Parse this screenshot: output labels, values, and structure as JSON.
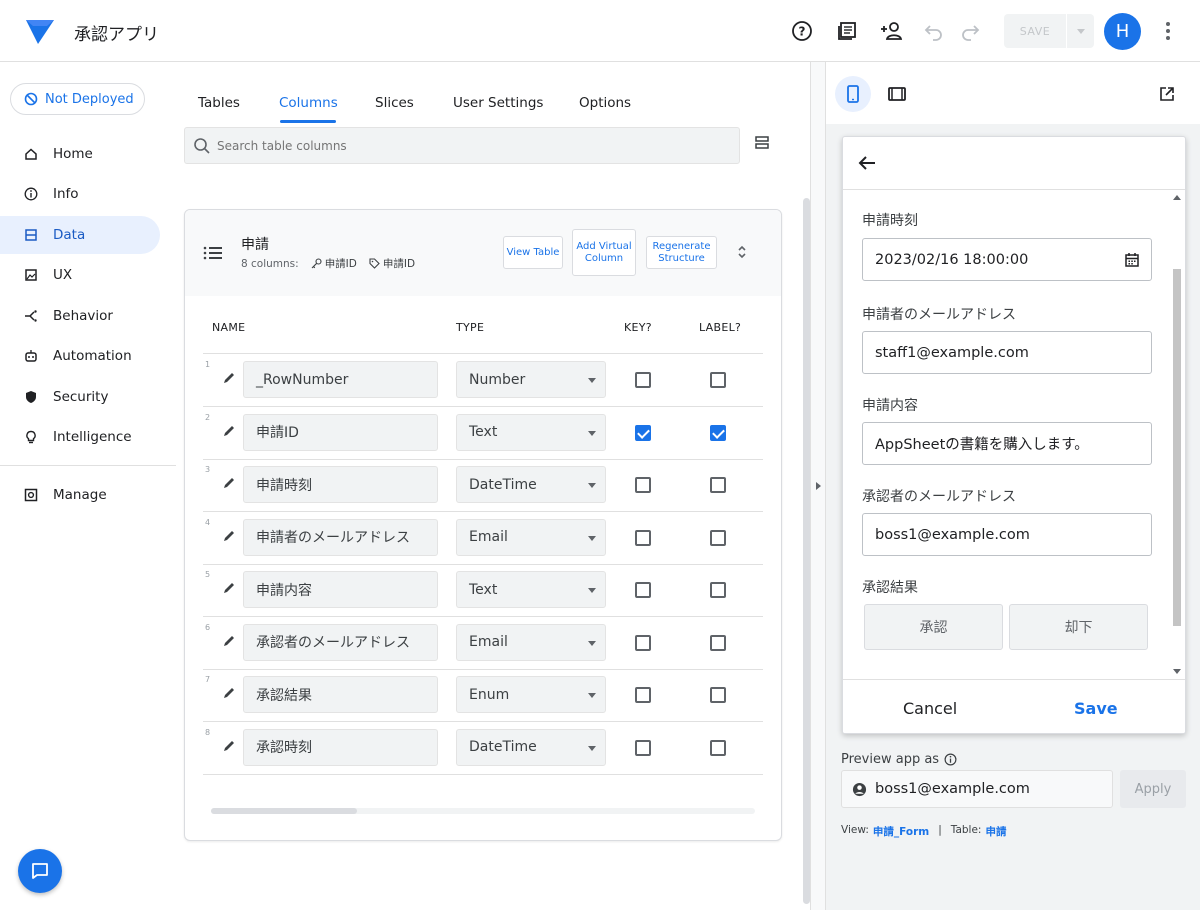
{
  "app": {
    "title": "承認アプリ"
  },
  "toolbar": {
    "save_label": "SAVE",
    "avatar_initial": "H"
  },
  "sidebar": {
    "deploy_status": "Not Deployed",
    "items": [
      {
        "label": "Home",
        "icon": "home-icon"
      },
      {
        "label": "Info",
        "icon": "info-icon"
      },
      {
        "label": "Data",
        "icon": "data-icon",
        "active": true
      },
      {
        "label": "UX",
        "icon": "ux-icon"
      },
      {
        "label": "Behavior",
        "icon": "behavior-icon"
      },
      {
        "label": "Automation",
        "icon": "automation-icon"
      },
      {
        "label": "Security",
        "icon": "security-icon"
      },
      {
        "label": "Intelligence",
        "icon": "intelligence-icon"
      },
      {
        "label": "Manage",
        "icon": "manage-icon"
      }
    ]
  },
  "tabs": [
    {
      "label": "Tables"
    },
    {
      "label": "Columns",
      "active": true
    },
    {
      "label": "Slices"
    },
    {
      "label": "User Settings"
    },
    {
      "label": "Options"
    }
  ],
  "search": {
    "placeholder": "Search table columns"
  },
  "table": {
    "name": "申請",
    "columns_count": "8 columns:",
    "key": "申請ID",
    "label": "申請ID",
    "buttons": {
      "view_table": "View Table",
      "add_virtual": "Add Virtual Column",
      "regenerate": "Regenerate Structure"
    },
    "headers": {
      "name": "NAME",
      "type": "TYPE",
      "key": "KEY?",
      "label": "LABEL?"
    },
    "rows": [
      {
        "num": "1",
        "name": "_RowNumber",
        "type": "Number",
        "key": false,
        "label": false
      },
      {
        "num": "2",
        "name": "申請ID",
        "type": "Text",
        "key": true,
        "label": true
      },
      {
        "num": "3",
        "name": "申請時刻",
        "type": "DateTime",
        "key": false,
        "label": false
      },
      {
        "num": "4",
        "name": "申請者のメールアドレス",
        "type": "Email",
        "key": false,
        "label": false
      },
      {
        "num": "5",
        "name": "申請内容",
        "type": "Text",
        "key": false,
        "label": false
      },
      {
        "num": "6",
        "name": "承認者のメールアドレス",
        "type": "Email",
        "key": false,
        "label": false
      },
      {
        "num": "7",
        "name": "承認結果",
        "type": "Enum",
        "key": false,
        "label": false
      },
      {
        "num": "8",
        "name": "承認時刻",
        "type": "DateTime",
        "key": false,
        "label": false
      }
    ]
  },
  "preview": {
    "form": {
      "fields": [
        {
          "label": "申請時刻",
          "value": "2023/02/16 18:00:00"
        },
        {
          "label": "申請者のメールアドレス",
          "value": "staff1@example.com"
        },
        {
          "label": "申請内容",
          "value": "AppSheetの書籍を購入します。"
        },
        {
          "label": "承認者のメールアドレス",
          "value": "boss1@example.com"
        }
      ],
      "enum_label": "承認結果",
      "enum_options": [
        "承認",
        "却下"
      ],
      "cancel": "Cancel",
      "save": "Save"
    },
    "preview_as_label": "Preview app as",
    "user_email": "boss1@example.com",
    "apply": "Apply",
    "view_prefix": "View:",
    "view_name": "申請_Form",
    "separator": "|",
    "table_prefix": "Table:",
    "table_name": "申請"
  },
  "colors": {
    "accent": "#1a73e8",
    "active_bg": "#e8f0fe"
  }
}
